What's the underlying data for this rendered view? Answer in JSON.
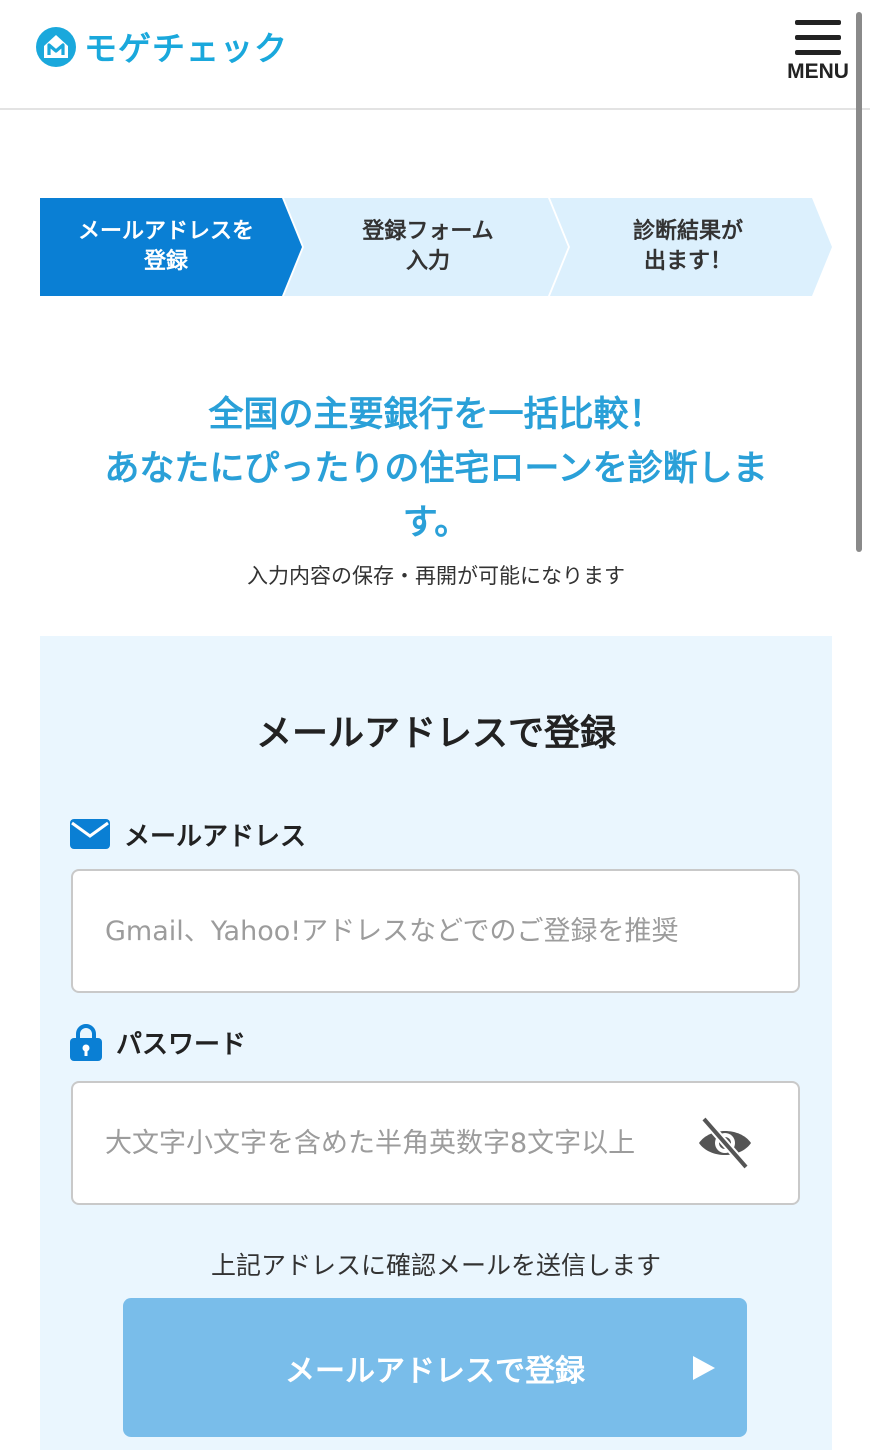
{
  "header": {
    "brand": "モゲチェック",
    "menu_label": "MENU"
  },
  "steps": [
    {
      "label": "メールアドレスを\n登録",
      "active": true
    },
    {
      "label": "登録フォーム\n入力",
      "active": false
    },
    {
      "label": "診断結果が\n出ます！",
      "active": false
    }
  ],
  "headline": {
    "line1": "全国の主要銀行を一括比較！",
    "line2": "あなたにぴったりの住宅ローンを診断しま",
    "line3": "す。",
    "sub": "入力内容の保存・再開が可能になります"
  },
  "form": {
    "title": "メールアドレスで登録",
    "email_label": "メールアドレス",
    "email_placeholder": "Gmail、Yahoo!アドレスなどでのご登録を推奨",
    "email_value": "",
    "password_label": "パスワード",
    "password_placeholder": "大文字小文字を含めた半角英数字8文字以上",
    "password_value": "",
    "notice": "上記アドレスに確認メールを送信します",
    "submit_label": "メールアドレスで登録"
  },
  "colors": {
    "brand": "#1aa8dc",
    "step_active": "#0a7fd4",
    "step_inactive": "#dcf0fd",
    "headline": "#2aa0d8",
    "panel_bg": "#eaf6fe",
    "icon_blue": "#0a7fd4",
    "button_bg": "#79bdea"
  },
  "icons": {
    "logo": "house-m-logo-icon",
    "menu": "hamburger-icon",
    "email": "envelope-icon",
    "password": "lock-icon",
    "toggle_password": "eye-slash-icon",
    "submit": "play-arrow-icon"
  }
}
